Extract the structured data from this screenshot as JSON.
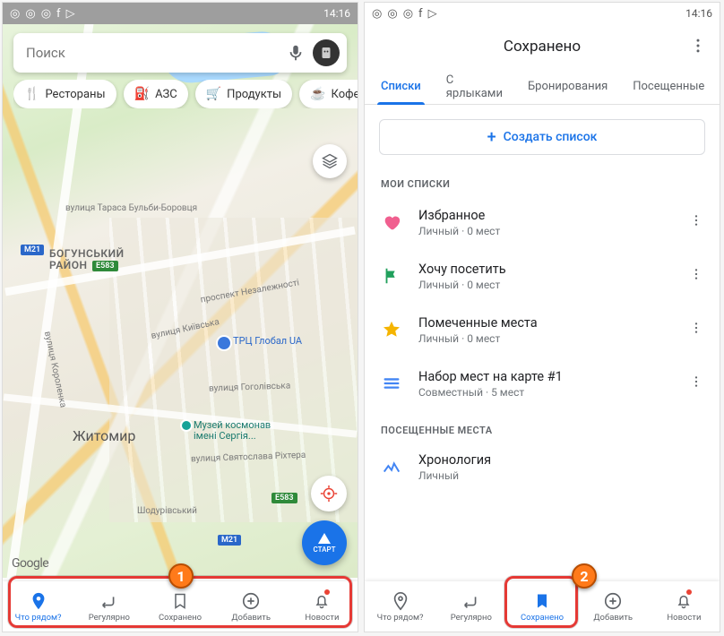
{
  "status": {
    "time": "14:16"
  },
  "left": {
    "search_placeholder": "Поиск",
    "chips": [
      {
        "icon": "🍴",
        "label": "Рестораны"
      },
      {
        "icon": "⛽",
        "label": "АЗС"
      },
      {
        "icon": "🛒",
        "label": "Продукты"
      },
      {
        "icon": "☕",
        "label": "Кофейн"
      }
    ],
    "map": {
      "city": "Житомир",
      "district": "БОГУНСЬКИЙ\nРАЙОН",
      "streets": {
        "s1": "вулиця Тараса Бульби-Боровця",
        "s2": "вулиця Київська",
        "s3": "вулиця Гоголівська",
        "s4": "вулиця Святослава Ріхтера",
        "s5": "Шодурівський",
        "s6": "проспект Незалежності",
        "s7": "вулиця Короленка"
      },
      "poi1": "ТРЦ Глобал UA",
      "poi2": "Музей космонав\nімені Сергія...",
      "route1": "M21",
      "route2": "M21",
      "route3": "E583",
      "route4": "E583",
      "google": "Google",
      "start_label": "СТАРТ"
    },
    "nav": [
      {
        "label": "Что рядом?",
        "active": true
      },
      {
        "label": "Регулярно"
      },
      {
        "label": "Сохранено"
      },
      {
        "label": "Добавить"
      },
      {
        "label": "Новости",
        "dot": true
      }
    ]
  },
  "right": {
    "header": "Сохранено",
    "tabs": [
      {
        "label": "Списки",
        "active": true
      },
      {
        "label": "С ярлыками"
      },
      {
        "label": "Бронирования"
      },
      {
        "label": "Посещенные"
      }
    ],
    "create_label": "Создать список",
    "section1": "МОИ СПИСКИ",
    "lists": [
      {
        "title": "Избранное",
        "sub": "Личный · 0 мест",
        "color": "#f05f8f",
        "icon": "heart"
      },
      {
        "title": "Хочу посетить",
        "sub": "Личный · 0 мест",
        "color": "#21a05c",
        "icon": "flag"
      },
      {
        "title": "Помеченные места",
        "sub": "Личный · 0 мест",
        "color": "#f5b400",
        "icon": "star"
      },
      {
        "title": "Набор мест на карте #1",
        "sub": "Совместный · 5 мест",
        "color": "#4285f4",
        "icon": "list"
      }
    ],
    "section2": "ПОСЕЩЕННЫЕ МЕСТА",
    "visited": {
      "title": "Хронология",
      "sub": "Личный"
    },
    "nav": [
      {
        "label": "Что рядом?"
      },
      {
        "label": "Регулярно"
      },
      {
        "label": "Сохранено",
        "active": true
      },
      {
        "label": "Добавить"
      },
      {
        "label": "Новости",
        "dot": true
      }
    ]
  },
  "annotations": {
    "n1": "1",
    "n2": "2"
  }
}
